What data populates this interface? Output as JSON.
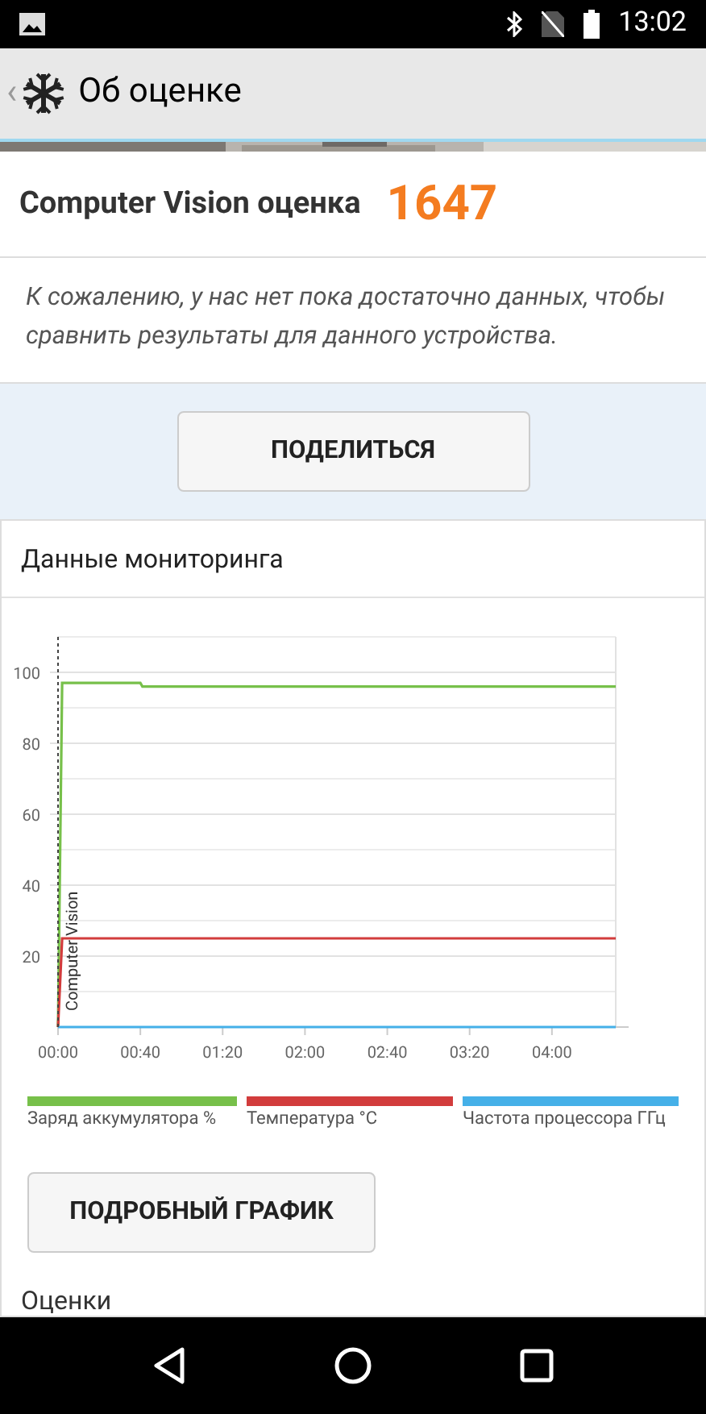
{
  "status_bar": {
    "time": "13:02"
  },
  "app_bar": {
    "back": "‹",
    "title": "Об оценке"
  },
  "score": {
    "label": "Computer Vision оценка",
    "value": "1647"
  },
  "notice": "К сожалению, у нас нет пока достаточно данных, чтобы сравнить результаты для данного устройства.",
  "share_button": "ПОДЕЛИТЬСЯ",
  "monitoring": {
    "title": "Данные мониторинга",
    "chart_data": {
      "type": "line",
      "x": [
        0,
        2,
        40,
        41,
        271
      ],
      "xlim": [
        0,
        271
      ],
      "ylim": [
        0,
        110
      ],
      "xticks": [
        {
          "value": 0,
          "label": "00:00"
        },
        {
          "value": 40,
          "label": "00:40"
        },
        {
          "value": 80,
          "label": "01:20"
        },
        {
          "value": 120,
          "label": "02:00"
        },
        {
          "value": 160,
          "label": "02:40"
        },
        {
          "value": 200,
          "label": "03:20"
        },
        {
          "value": 240,
          "label": "04:00"
        }
      ],
      "yticks": [
        20,
        40,
        60,
        80,
        100
      ],
      "series": [
        {
          "name": "Заряд аккумулятора %",
          "color": "#77c04a",
          "values": [
            0,
            97,
            97,
            96,
            96
          ]
        },
        {
          "name": "Температура °C",
          "color": "#d23c3c",
          "values": [
            0,
            25,
            25,
            25,
            25
          ]
        },
        {
          "name": "Частота процессора ГГц",
          "color": "#45b0e8",
          "values": [
            0,
            0,
            0,
            0,
            0
          ]
        }
      ],
      "grid": true,
      "annotations": [
        {
          "x": 0,
          "text": "Computer Vision"
        }
      ]
    },
    "detail_button": "ПОДРОБНЫЙ ГРАФИК"
  },
  "ratings_title": "Оценки"
}
